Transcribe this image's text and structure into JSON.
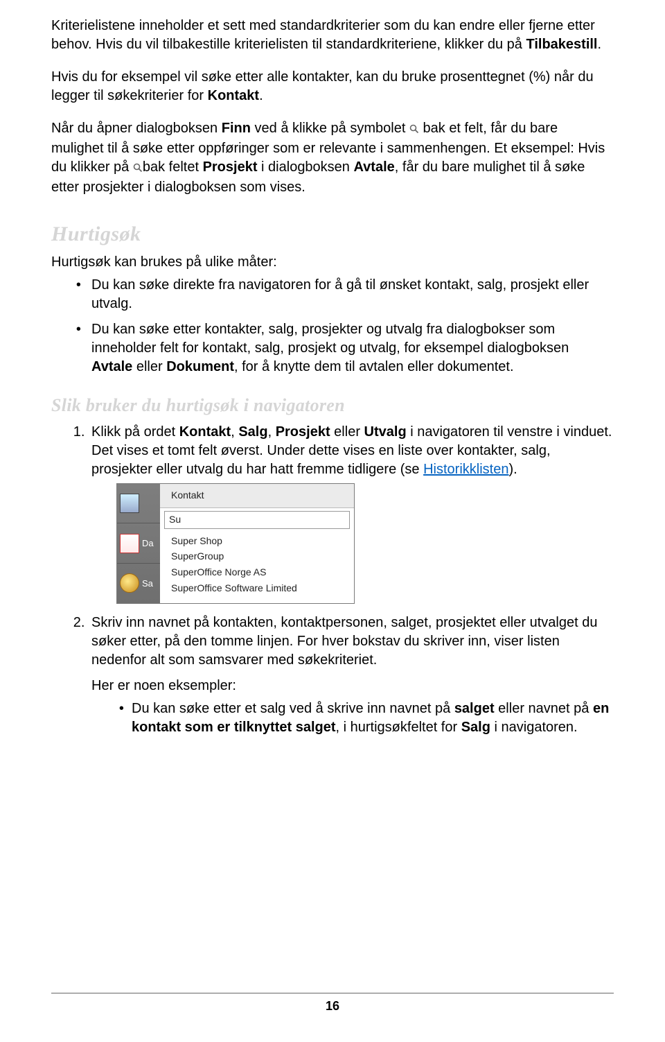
{
  "intro": {
    "p1a": "Kriterielistene inneholder et sett med standardkriterier som du kan endre eller fjerne etter behov. Hvis du vil tilbakestille kriterielisten til standardkriteriene, klikker du på ",
    "p1b": "Tilbakestill",
    "p1c": ".",
    "p2a": "Hvis du for eksempel vil søke etter alle kontakter, kan du bruke prosenttegnet (%) når du legger til søkekriterier for ",
    "p2b": "Kontakt",
    "p2c": ".",
    "p3a": "Når du åpner dialogboksen ",
    "p3b": "Finn",
    "p3c": " ved å klikke på symbolet ",
    "p3d": " bak et felt, får du bare mulighet til å søke etter oppføringer som er relevante i sammenhengen. Et eksempel: Hvis du klikker på ",
    "p3e": "bak feltet ",
    "p3f": "Prosjekt",
    "p3g": " i dialogboksen ",
    "p3h": "Avtale",
    "p3i": ", får du bare mulighet til å søke etter prosjekter i dialogboksen som vises."
  },
  "hurtigsok": {
    "heading": "Hurtigsøk",
    "lead": "Hurtigsøk kan brukes på ulike måter:",
    "b1": "Du kan søke direkte fra navigatoren for å gå til ønsket kontakt, salg, prosjekt eller utvalg.",
    "b2a": "Du kan søke etter kontakter, salg, prosjekter og utvalg fra dialogbokser som inneholder felt for kontakt, salg, prosjekt og utvalg, for eksempel dialogboksen ",
    "b2b": "Avtale",
    "b2c": " eller ",
    "b2d": "Dokument",
    "b2e": ", for å knytte dem til avtalen eller dokumentet."
  },
  "nav": {
    "heading": "Slik bruker du hurtigsøk i navigatoren",
    "s1a": "Klikk på ordet ",
    "s1b": "Kontakt",
    "s1c": ", ",
    "s1d": "Salg",
    "s1e": ", ",
    "s1f": "Prosjekt",
    "s1g": " eller ",
    "s1h": "Utvalg",
    "s1i": " i navigatoren til venstre i vinduet. Det vises et tomt felt øverst. Under dette vises en liste over kontakter, salg, prosjekter eller utvalg du har hatt fremme tidligere (se ",
    "s1link": "Historikklisten",
    "s1j": ").",
    "ui": {
      "label_kontakt": "Kontakt",
      "left_da": "Da",
      "left_sa": "Sa",
      "input_value": "Su",
      "list": [
        "Super Shop",
        "SuperGroup",
        "SuperOffice Norge AS",
        "SuperOffice Software Limited"
      ]
    },
    "s2": "Skriv inn navnet på kontakten, kontaktpersonen, salget, prosjektet eller utvalget du søker etter, på den tomme linjen. For hver bokstav du skriver inn, viser listen nedenfor alt som samsvarer med søkekriteriet.",
    "ex_label": "Her er noen eksempler:",
    "ex1a": "Du kan søke etter et salg ved å skrive inn navnet på ",
    "ex1b": "salget",
    "ex1c": " eller navnet på ",
    "ex1d": "en kontakt som er tilknyttet salget",
    "ex1e": ", i hurtigsøkfeltet for ",
    "ex1f": "Salg",
    "ex1g": " i navigatoren."
  },
  "page_number": "16"
}
